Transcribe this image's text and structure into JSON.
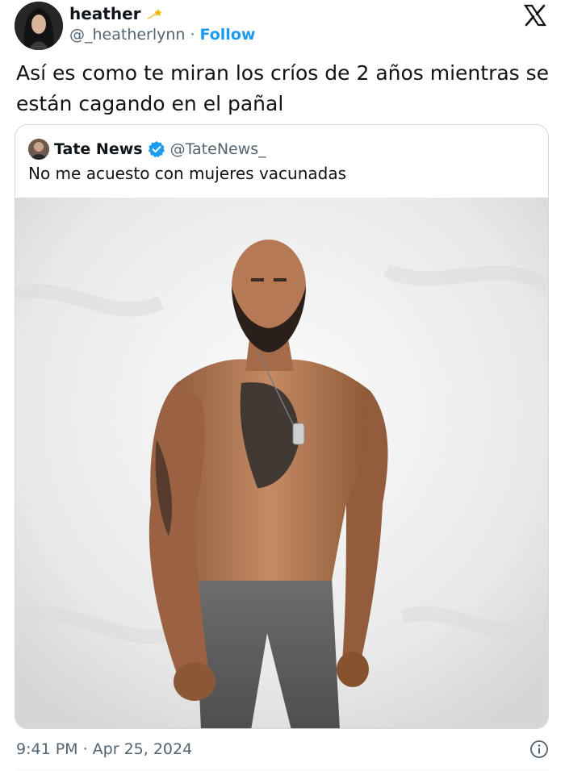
{
  "author": {
    "display_name": "heather",
    "badge_icon": "shooting-star-icon",
    "handle": "@_heatherlynn",
    "separator": "·",
    "follow_label": "Follow"
  },
  "platform_icon": "x-logo-icon",
  "tweet": {
    "text": "Así es como te miran los críos de 2 años mientras se están cagando en el pañal"
  },
  "quoted_tweet": {
    "display_name": "Tate News",
    "verified_icon": "verified-badge-icon",
    "handle": "@TateNews_",
    "text": "No me acuesto con mujeres vacunadas",
    "media_icon": "photo-shirtless-man"
  },
  "footer": {
    "timestamp": "9:41 PM · Apr 25, 2024",
    "info_icon": "info-icon"
  },
  "colors": {
    "accent": "#1d9bf0",
    "text_primary": "#0f1419",
    "text_secondary": "#536471",
    "border": "#cfd9de"
  }
}
